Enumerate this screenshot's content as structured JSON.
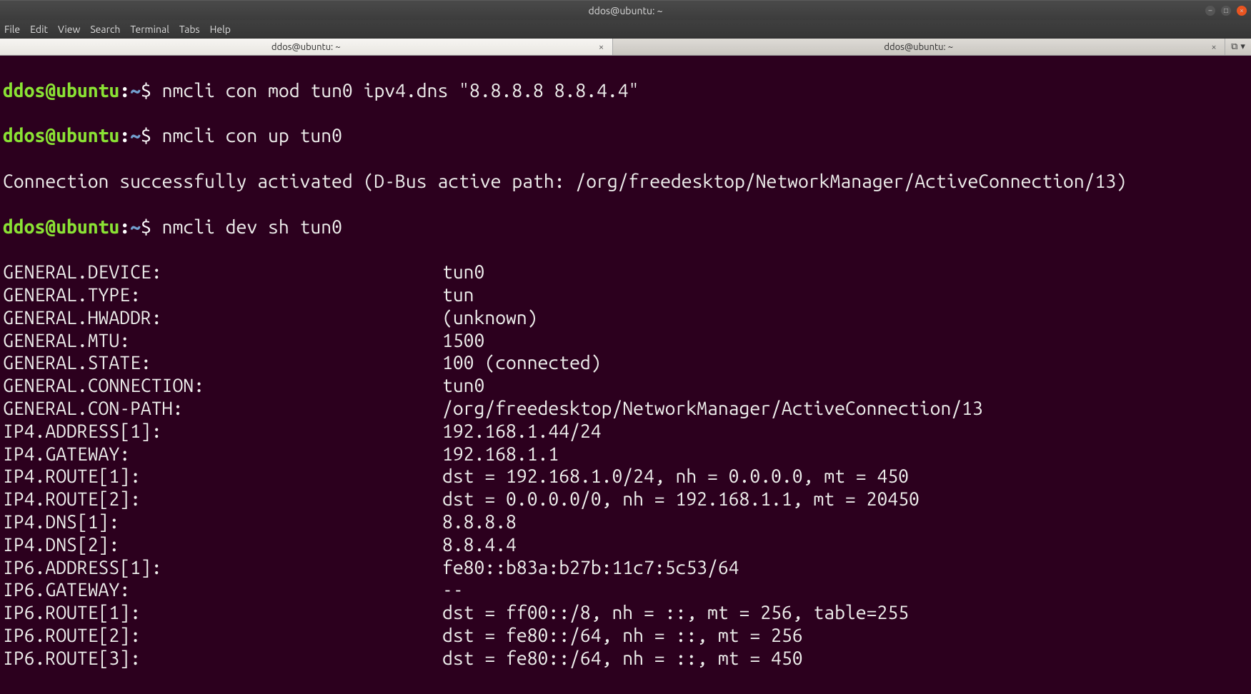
{
  "titlebar": {
    "title": "ddos@ubuntu: ~"
  },
  "menubar": {
    "items": [
      "File",
      "Edit",
      "View",
      "Search",
      "Terminal",
      "Tabs",
      "Help"
    ]
  },
  "tabs": [
    {
      "label": "ddos@ubuntu: ~",
      "active": true
    },
    {
      "label": "ddos@ubuntu: ~",
      "active": false
    }
  ],
  "prompt": {
    "user": "ddos",
    "at": "@",
    "host": "ubuntu",
    "colon": ":",
    "path": "~",
    "symbol": "$ "
  },
  "lines": {
    "cmd1": "nmcli con mod tun0 ipv4.dns \"8.8.8.8 8.8.4.4\"",
    "cmd2": "nmcli con up tun0",
    "out2": "Connection successfully activated (D-Bus active path: /org/freedesktop/NetworkManager/ActiveConnection/13)",
    "cmd3": "nmcli dev sh tun0"
  },
  "devinfo": [
    {
      "key": "GENERAL.DEVICE:",
      "val": "tun0"
    },
    {
      "key": "GENERAL.TYPE:",
      "val": "tun"
    },
    {
      "key": "GENERAL.HWADDR:",
      "val": "(unknown)"
    },
    {
      "key": "GENERAL.MTU:",
      "val": "1500"
    },
    {
      "key": "GENERAL.STATE:",
      "val": "100 (connected)"
    },
    {
      "key": "GENERAL.CONNECTION:",
      "val": "tun0"
    },
    {
      "key": "GENERAL.CON-PATH:",
      "val": "/org/freedesktop/NetworkManager/ActiveConnection/13"
    },
    {
      "key": "IP4.ADDRESS[1]:",
      "val": "192.168.1.44/24"
    },
    {
      "key": "IP4.GATEWAY:",
      "val": "192.168.1.1"
    },
    {
      "key": "IP4.ROUTE[1]:",
      "val": "dst = 192.168.1.0/24, nh = 0.0.0.0, mt = 450"
    },
    {
      "key": "IP4.ROUTE[2]:",
      "val": "dst = 0.0.0.0/0, nh = 192.168.1.1, mt = 20450"
    },
    {
      "key": "IP4.DNS[1]:",
      "val": "8.8.8.8"
    },
    {
      "key": "IP4.DNS[2]:",
      "val": "8.8.4.4"
    },
    {
      "key": "IP6.ADDRESS[1]:",
      "val": "fe80::b83a:b27b:11c7:5c53/64"
    },
    {
      "key": "IP6.GATEWAY:",
      "val": "--"
    },
    {
      "key": "IP6.ROUTE[1]:",
      "val": "dst = ff00::/8, nh = ::, mt = 256, table=255"
    },
    {
      "key": "IP6.ROUTE[2]:",
      "val": "dst = fe80::/64, nh = ::, mt = 256"
    },
    {
      "key": "IP6.ROUTE[3]:",
      "val": "dst = fe80::/64, nh = ::, mt = 450"
    }
  ]
}
